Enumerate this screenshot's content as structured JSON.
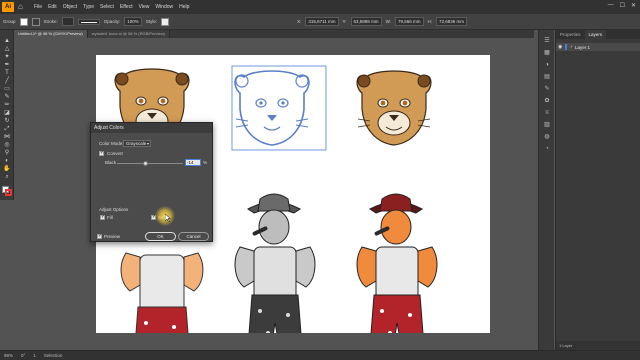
{
  "app": {
    "logo": "Ai",
    "menu": [
      "File",
      "Edit",
      "Object",
      "Type",
      "Select",
      "Effect",
      "View",
      "Window",
      "Help"
    ]
  },
  "controlbar": {
    "selection": "Group",
    "stroke_label": "Stroke:",
    "opacity_label": "Opacity:",
    "opacity_value": "100%",
    "style_label": "Style:",
    "x_value": "315,6711 mm",
    "y_value": "63,5898 mm",
    "w_value": "79,666 mm",
    "h_value": "72,6836 mm"
  },
  "tabs": [
    {
      "label": "Untitled-1* @ 98 % (CMYK/Preview)"
    },
    {
      "label": "wyświetl. kuna ai @ 58 % (RGB/Preview)"
    }
  ],
  "dialog": {
    "title": "Adjust Colors",
    "color_mode_label": "Color Mode:",
    "color_mode_value": "Grayscale",
    "convert_label": "Convert",
    "convert_checked": true,
    "black_label": "Black",
    "black_value": "-14",
    "black_unit": "%",
    "black_level": 0.43,
    "adjust_options_label": "Adjust Options",
    "fill_label": "Fill",
    "fill_checked": true,
    "stroke_label": "Stroke",
    "stroke_checked": true,
    "preview_label": "Preview",
    "preview_checked": true,
    "ok_label": "OK",
    "cancel_label": "Cancel"
  },
  "panels": {
    "tabs": [
      "Properties",
      "Layers"
    ],
    "active": "Layers",
    "layer_name": "Layer 1",
    "footer": "1 Layer"
  },
  "status": {
    "zoom": "98%",
    "rotation": "0°",
    "page": "1",
    "tool": "Selection"
  },
  "colors": {
    "accent": "#4b82d6",
    "lion_tan": "#d19a55",
    "outline_blue": "#5b7fc9",
    "hat_red": "#8b2020",
    "shorts_red": "#b3232a",
    "skin_orange": "#f08a3c"
  }
}
